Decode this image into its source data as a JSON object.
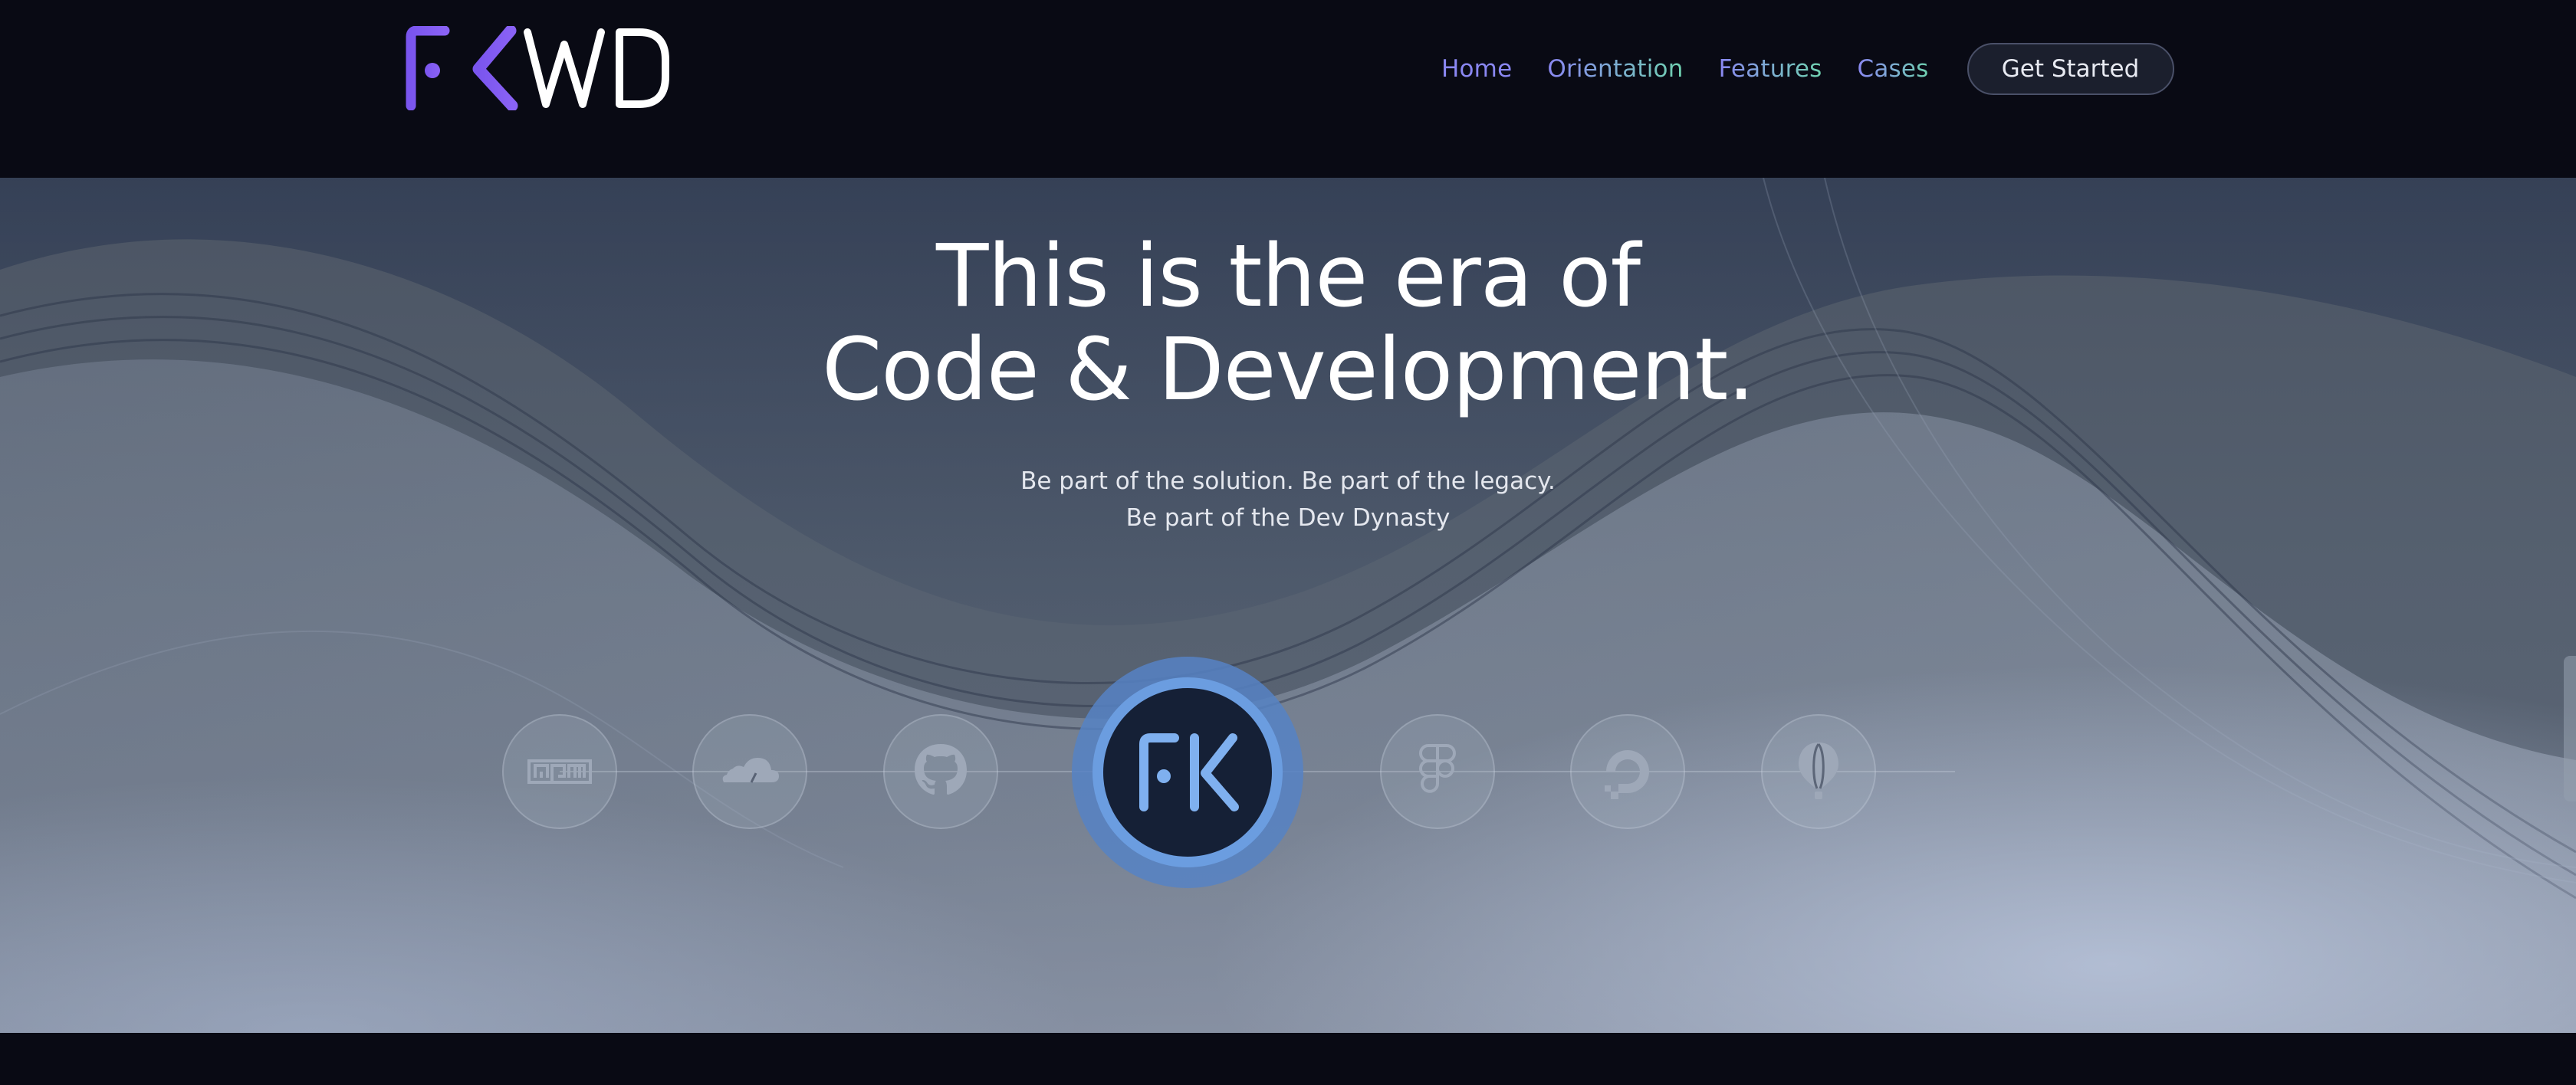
{
  "brand": {
    "logo_text": "FKWD",
    "primary_color": "#7b57f0",
    "secondary_color": "#ffffff"
  },
  "nav": {
    "items": [
      {
        "label": "Home",
        "color": "#8a87f2"
      },
      {
        "label": "Orientation",
        "color": "#8ab0f0"
      },
      {
        "label": "Features",
        "color": "#8a87f2"
      },
      {
        "label": "Cases",
        "color": "#8a87f2"
      }
    ],
    "cta_label": "Get Started"
  },
  "hero": {
    "headline_line1": "This is the era of",
    "headline_line2": "Code & Development.",
    "sub_line1": "Be part of the solution. Be part of the legacy.",
    "sub_line2": "Be part of the Dev Dynasty"
  },
  "tools": [
    {
      "icon": "npm-icon"
    },
    {
      "icon": "cloudflare-icon"
    },
    {
      "icon": "github-icon"
    },
    {
      "icon": "fk-logo-icon",
      "featured": true
    },
    {
      "icon": "figma-icon"
    },
    {
      "icon": "digitalocean-icon"
    },
    {
      "icon": "balloon-icon"
    }
  ],
  "colors": {
    "header_bg": "#090a14",
    "accent_blue": "#6b9de0",
    "hero_bg": "#55606f"
  }
}
